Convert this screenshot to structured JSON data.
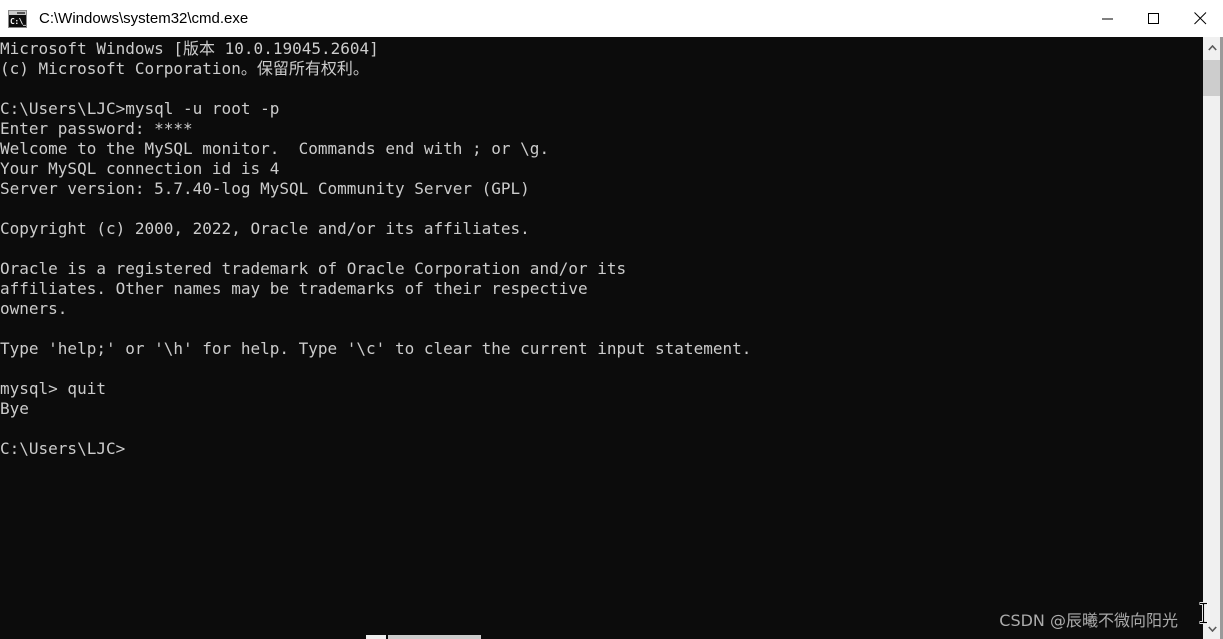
{
  "window": {
    "title": "C:\\Windows\\system32\\cmd.exe",
    "icon": "cmd-terminal-icon",
    "icon_glyph": "C:\\_",
    "titlebar_bg": "#ffffff",
    "titlebar_fg": "#000000",
    "terminal_bg": "#0c0c0c",
    "terminal_fg": "#cccccc"
  },
  "window_controls": {
    "minimize_label": "Minimize",
    "maximize_label": "Maximize",
    "close_label": "Close"
  },
  "terminal": {
    "content": "Microsoft Windows [版本 10.0.19045.2604]\n(c) Microsoft Corporation。保留所有权利。\n\nC:\\Users\\LJC>mysql -u root -p\nEnter password: ****\nWelcome to the MySQL monitor.  Commands end with ; or \\g.\nYour MySQL connection id is 4\nServer version: 5.7.40-log MySQL Community Server (GPL)\n\nCopyright (c) 2000, 2022, Oracle and/or its affiliates.\n\nOracle is a registered trademark of Oracle Corporation and/or its\naffiliates. Other names may be trademarks of their respective\nowners.\n\nType 'help;' or '\\h' for help. Type '\\c' to clear the current input statement.\n\nmysql> quit\nBye\n\nC:\\Users\\LJC>",
    "lines": [
      "Microsoft Windows [版本 10.0.19045.2604]",
      "(c) Microsoft Corporation。保留所有权利。",
      "",
      "C:\\Users\\LJC>mysql -u root -p",
      "Enter password: ****",
      "Welcome to the MySQL monitor.  Commands end with ; or \\g.",
      "Your MySQL connection id is 4",
      "Server version: 5.7.40-log MySQL Community Server (GPL)",
      "",
      "Copyright (c) 2000, 2022, Oracle and/or its affiliates.",
      "",
      "Oracle is a registered trademark of Oracle Corporation and/or its",
      "affiliates. Other names may be trademarks of their respective",
      "owners.",
      "",
      "Type 'help;' or '\\h' for help. Type '\\c' to clear the current input statement.",
      "",
      "mysql> quit",
      "Bye",
      "",
      "C:\\Users\\LJC>"
    ],
    "prompt": "C:\\Users\\LJC>",
    "mysql_prompt": "mysql>",
    "last_command": "quit",
    "mysql_version": "5.7.40-log",
    "mysql_server": "MySQL Community Server (GPL)",
    "connection_id": "4",
    "windows_version": "10.0.19045.2604"
  },
  "watermark": {
    "text": "CSDN @辰曦不微向阳光"
  },
  "scrollbars": {
    "vertical_up_arrow": "▲",
    "vertical_down_arrow": "▼"
  }
}
